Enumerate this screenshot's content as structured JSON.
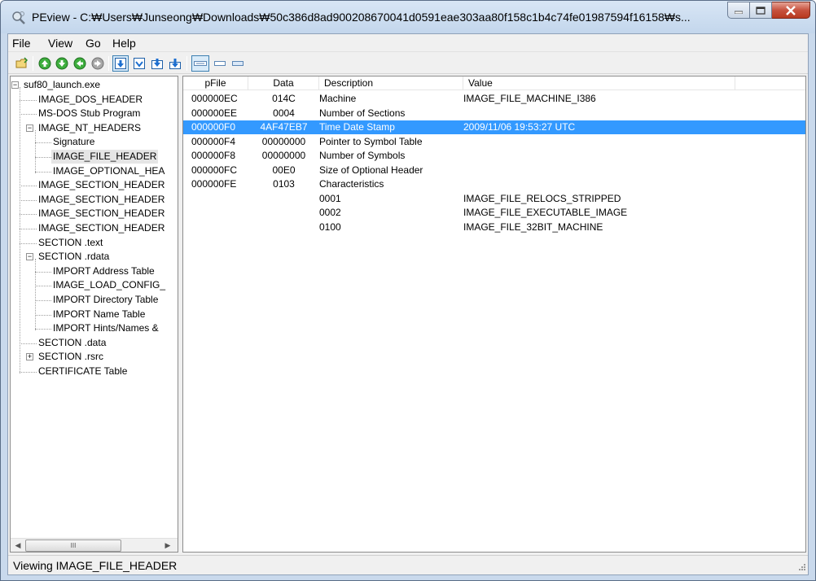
{
  "window": {
    "title": "PEview - C:₩Users₩Junseong₩Downloads₩50c386d8ad900208670041d0591eae303aa80f158c1b4c74fe01987594f16158₩s..."
  },
  "menu": {
    "items": [
      "File",
      "View",
      "Go",
      "Help"
    ]
  },
  "tree": {
    "items": [
      {
        "label": "suf80_launch.exe",
        "level": 0,
        "expander": "minus"
      },
      {
        "label": "IMAGE_DOS_HEADER",
        "level": 1
      },
      {
        "label": "MS-DOS Stub Program",
        "level": 1
      },
      {
        "label": "IMAGE_NT_HEADERS",
        "level": 1,
        "expander": "minus"
      },
      {
        "label": "Signature",
        "level": 2
      },
      {
        "label": "IMAGE_FILE_HEADER",
        "level": 2,
        "selected": true
      },
      {
        "label": "IMAGE_OPTIONAL_HEA",
        "level": 2
      },
      {
        "label": "IMAGE_SECTION_HEADER",
        "level": 1
      },
      {
        "label": "IMAGE_SECTION_HEADER",
        "level": 1
      },
      {
        "label": "IMAGE_SECTION_HEADER",
        "level": 1
      },
      {
        "label": "IMAGE_SECTION_HEADER",
        "level": 1
      },
      {
        "label": "SECTION .text",
        "level": 1
      },
      {
        "label": "SECTION .rdata",
        "level": 1,
        "expander": "minus"
      },
      {
        "label": "IMPORT Address Table",
        "level": 2
      },
      {
        "label": "IMAGE_LOAD_CONFIG_",
        "level": 2
      },
      {
        "label": "IMPORT Directory Table",
        "level": 2
      },
      {
        "label": "IMPORT Name Table",
        "level": 2
      },
      {
        "label": "IMPORT Hints/Names &",
        "level": 2
      },
      {
        "label": "SECTION .data",
        "level": 1
      },
      {
        "label": "SECTION .rsrc",
        "level": 1,
        "expander": "plus"
      },
      {
        "label": "CERTIFICATE Table",
        "level": 1
      }
    ],
    "scroll_thumb_glyph": "III",
    "scroll_left": "◀",
    "scroll_right": "▶"
  },
  "list": {
    "columns": [
      "pFile",
      "Data",
      "Description",
      "Value"
    ],
    "rows": [
      {
        "pfile": "000000EC",
        "data": "014C",
        "desc": "Machine",
        "value": "IMAGE_FILE_MACHINE_I386"
      },
      {
        "pfile": "000000EE",
        "data": "0004",
        "desc": "Number of Sections",
        "value": ""
      },
      {
        "pfile": "000000F0",
        "data": "4AF47EB7",
        "desc": "Time Date Stamp",
        "value": "2009/11/06  19:53:27 UTC",
        "selected": true
      },
      {
        "pfile": "000000F4",
        "data": "00000000",
        "desc": "Pointer to Symbol Table",
        "value": ""
      },
      {
        "pfile": "000000F8",
        "data": "00000000",
        "desc": "Number of Symbols",
        "value": ""
      },
      {
        "pfile": "000000FC",
        "data": "00E0",
        "desc": "Size of Optional Header",
        "value": ""
      },
      {
        "pfile": "000000FE",
        "data": "0103",
        "desc": "Characteristics",
        "value": ""
      },
      {
        "pfile": "",
        "data": "",
        "desc": "0001",
        "value": "IMAGE_FILE_RELOCS_STRIPPED"
      },
      {
        "pfile": "",
        "data": "",
        "desc": "0002",
        "value": "IMAGE_FILE_EXECUTABLE_IMAGE"
      },
      {
        "pfile": "",
        "data": "",
        "desc": "0100",
        "value": "IMAGE_FILE_32BIT_MACHINE"
      }
    ]
  },
  "status": {
    "text": "Viewing IMAGE_FILE_HEADER"
  },
  "colors": {
    "selection": "#3399ff",
    "title_bg": "#c9d9ec",
    "close_button": "#c7523f"
  }
}
